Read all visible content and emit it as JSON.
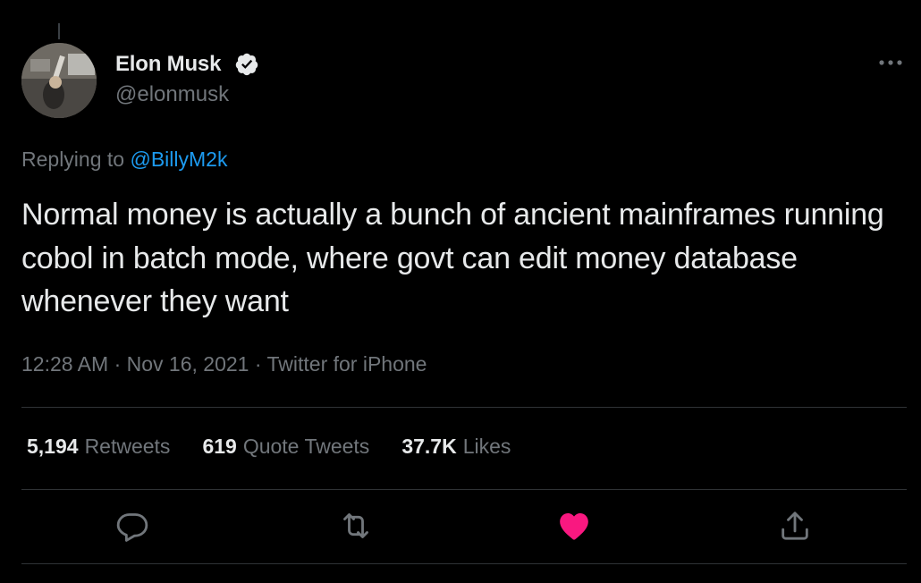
{
  "author": {
    "name": "Elon Musk",
    "handle": "@elonmusk",
    "verified": true,
    "avatar_icon": "profile-photo"
  },
  "reply": {
    "prefix": "Replying to ",
    "mention": "@BillyM2k"
  },
  "tweet": {
    "text": "Normal money is actually a bunch of ancient mainframes running cobol in batch mode, where govt can edit money database whenever they want"
  },
  "meta": {
    "time": "12:28 AM",
    "separator": " · ",
    "date": "Nov 16, 2021",
    "source": "Twitter for iPhone"
  },
  "stats": {
    "retweets": {
      "count": "5,194",
      "label": "Retweets"
    },
    "quotes": {
      "count": "619",
      "label": "Quote Tweets"
    },
    "likes": {
      "count": "37.7K",
      "label": "Likes"
    }
  },
  "actions": {
    "reply_icon": "reply-icon",
    "retweet_icon": "retweet-icon",
    "like_icon": "heart-icon",
    "share_icon": "share-icon",
    "liked": true
  },
  "colors": {
    "background": "#000000",
    "text": "#e7e9ea",
    "secondary": "#71767b",
    "accent": "#1d9bf0",
    "like": "#f91880",
    "divider": "#2f3336"
  }
}
